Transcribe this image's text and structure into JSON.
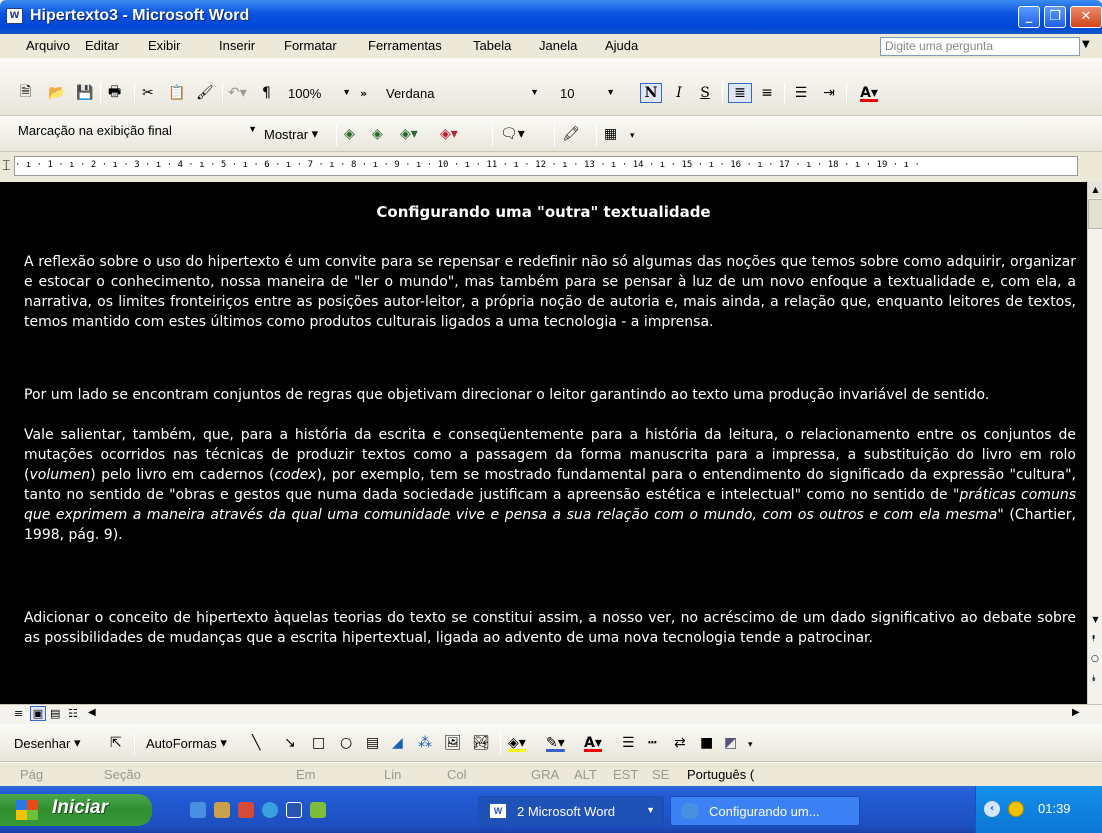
{
  "window": {
    "title": "Hipertexto3 - Microsoft Word",
    "app_icon": "W"
  },
  "menu": {
    "items": [
      "Arquivo",
      "Editar",
      "Exibir",
      "Inserir",
      "Formatar",
      "Ferramentas",
      "Tabela",
      "Janela",
      "Ajuda"
    ],
    "ask_placeholder": "Digite uma pergunta"
  },
  "standard_toolbar": {
    "zoom": "100%",
    "font": "Verdana",
    "size": "10",
    "bold": "N",
    "italic": "I",
    "underline": "S"
  },
  "review_toolbar": {
    "markup_view": "Marcação na exibição final",
    "show_label": "Mostrar"
  },
  "ruler": {
    "text": "· ı · 1 · ı · 2 · ı · 3 · ı · 4 · ı · 5 · ı · 6 · ı · 7 · ı · 8 · ı · 9 · ı · 10 · ı · 11 · ı · 12 · ı · 13 · ı · 14 · ı · 15 · ı · 16 · ı · 17 · ı · 18 · ı · 19 · ı ·"
  },
  "document": {
    "title": "Configurando uma \"outra\" textualidade",
    "p1": "A reflexão sobre o uso do hipertexto é um convite para se repensar e redefinir não só algumas das noções que temos sobre como adquirir, organizar e estocar o conhecimento, nossa maneira de \"ler o mundo\", mas também para se pensar à luz de um novo enfoque a textualidade e, com ela, a narrativa, os limites fronteiriços entre as posições autor-leitor, a própria noção de autoria e, mais ainda, a relação que, enquanto leitores de textos, temos mantido com estes últimos como produtos culturais ligados a uma tecnologia - a imprensa.",
    "p2": "Por um lado se encontram conjuntos de regras que objetivam direcionar o leitor garantindo ao texto uma produção invariável de sentido.",
    "p3a": "Vale salientar, também, que, para a história da escrita e conseqüentemente para a história da leitura, o relacionamento entre os conjuntos de mutações ocorridos nas técnicas de produzir textos como a passagem da forma manuscrita para a impressa, a substituição do livro em rolo (",
    "p3_volumen": "volumen",
    "p3b": ") pelo livro em cadernos (",
    "p3_codex": "codex",
    "p3c": "), por exemplo, tem se mostrado fundamental para o entendimento do significado da expressão \"cultura\", tanto no sentido de \"obras e gestos que numa dada sociedade justificam a apreensão estética e intelectual\" como no sentido de ",
    "p3_quote": "\"práticas comuns que exprimem a maneira através da qual uma comunidade vive e pensa a sua relação com o mundo, com os outros e com ela mesma\"",
    "p3d": " (Chartier, 1998, pág. 9).",
    "p4": "Adicionar o conceito de hipertexto àquelas teorias do texto se constitui assim, a nosso ver, no acréscimo de um dado significativo ao debate sobre as possibilidades de mudanças que a escrita hipertextual, ligada ao advento de uma nova tecnologia tende a patrocinar."
  },
  "drawing_toolbar": {
    "draw_label": "Desenhar",
    "autoshapes_label": "AutoFormas"
  },
  "statusbar": {
    "pag": "Pág",
    "secao": "Seção",
    "em": "Em",
    "lin": "Lin",
    "col": "Col",
    "grv": "GRA",
    "alt": "ALT",
    "est": "EST",
    "se": "SE",
    "language": "Português ("
  },
  "taskbar": {
    "start": "Iniciar",
    "tasks": [
      "2 Microsoft Word",
      "Configurando um..."
    ],
    "clock": "01:39"
  }
}
